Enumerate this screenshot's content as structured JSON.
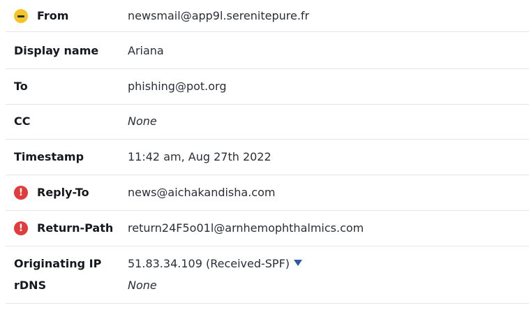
{
  "headers": {
    "from": {
      "label": "From",
      "value": "newsmail@app9l.serenitepure.fr",
      "status_icon": "minus-circle-icon",
      "status_color": "#f4c42b"
    },
    "display_name": {
      "label": "Display name",
      "value": "Ariana"
    },
    "to": {
      "label": "To",
      "value": "phishing@pot.org"
    },
    "cc": {
      "label": "CC",
      "value": "None"
    },
    "timestamp": {
      "label": "Timestamp",
      "value": "11:42 am, Aug 27th 2022"
    },
    "reply_to": {
      "label": "Reply-To",
      "value": "news@aichakandisha.com",
      "status_icon": "exclamation-circle-icon",
      "status_color": "#e23b3b"
    },
    "return_path": {
      "label": "Return-Path",
      "value": "return24F5o01l@arnhemophthalmics.com",
      "status_icon": "exclamation-circle-icon",
      "status_color": "#e23b3b"
    },
    "originating_ip": {
      "label": "Originating IP",
      "value": "51.83.34.109 (Received-SPF)",
      "dropdown_icon": "caret-down-icon",
      "link_color": "#2f5aa8"
    },
    "rdns": {
      "label": "rDNS",
      "value": "None"
    }
  }
}
